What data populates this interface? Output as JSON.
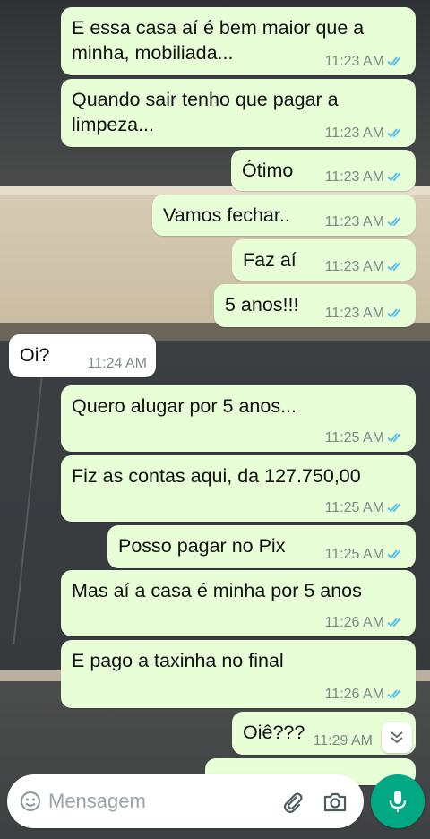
{
  "messages": [
    {
      "id": "m1",
      "direction": "out",
      "text": "E essa casa aí é bem maior que a minha, mobiliada...",
      "time": "11:23 AM",
      "status": "read"
    },
    {
      "id": "m2",
      "direction": "out",
      "text": "Quando sair tenho que pagar a limpeza...",
      "time": "11:23 AM",
      "status": "read"
    },
    {
      "id": "m3",
      "direction": "out",
      "text": "Ótimo",
      "time": "11:23 AM",
      "status": "read"
    },
    {
      "id": "m4",
      "direction": "out",
      "text": "Vamos fechar..",
      "time": "11:23 AM",
      "status": "read"
    },
    {
      "id": "m5",
      "direction": "out",
      "text": "Faz aí",
      "time": "11:23 AM",
      "status": "read"
    },
    {
      "id": "m6",
      "direction": "out",
      "text": "5 anos!!!",
      "time": "11:23 AM",
      "status": "read"
    },
    {
      "id": "m7",
      "direction": "in",
      "text": "Oi?",
      "time": "11:24 AM"
    },
    {
      "id": "m8",
      "direction": "out",
      "text": "Quero alugar por 5 anos...",
      "time": "11:25 AM",
      "status": "read"
    },
    {
      "id": "m9",
      "direction": "out",
      "text": "Fiz as contas aqui, da 127.750,00",
      "time": "11:25 AM",
      "status": "read"
    },
    {
      "id": "m10",
      "direction": "out",
      "text": "Posso pagar no Pix",
      "time": "11:25 AM",
      "status": "read"
    },
    {
      "id": "m11",
      "direction": "out",
      "text": "Mas aí a casa é minha por 5 anos",
      "time": "11:26 AM",
      "status": "read"
    },
    {
      "id": "m12",
      "direction": "out",
      "text": "E pago a taxinha no final",
      "time": "11:26 AM",
      "status": "read"
    },
    {
      "id": "m13",
      "direction": "out",
      "text": "Oiê???",
      "time": "11:29 AM",
      "status": "read"
    }
  ],
  "composer": {
    "placeholder": "Mensagem",
    "emoji_icon": "emoji-icon",
    "attach_icon": "paperclip-icon",
    "camera_icon": "camera-icon",
    "mic_icon": "microphone-icon"
  },
  "colors": {
    "outgoing_bubble": "#e7fed6",
    "incoming_bubble": "#ffffff",
    "read_ticks": "#53bdeb",
    "accent": "#00a884"
  }
}
